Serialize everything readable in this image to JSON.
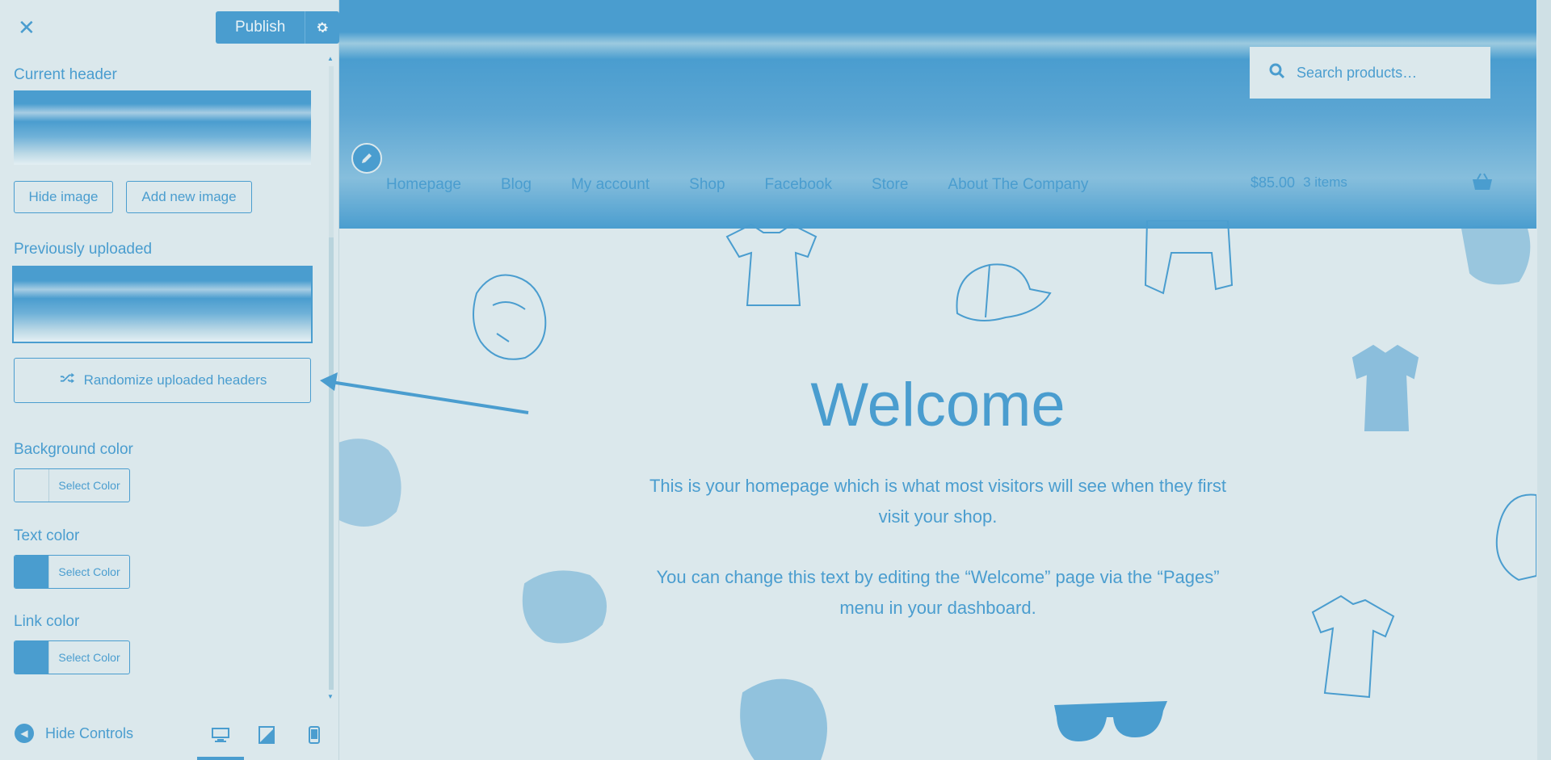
{
  "sidebar": {
    "close_icon": "close-icon",
    "publish_label": "Publish",
    "current_header_title": "Current header",
    "hide_image_label": "Hide image",
    "add_new_image_label": "Add new image",
    "previously_uploaded_title": "Previously uploaded",
    "randomize_label": "Randomize uploaded headers",
    "colors": [
      {
        "title": "Background color",
        "button_label": "Select Color",
        "swatch": "#dbe8ec"
      },
      {
        "title": "Text color",
        "button_label": "Select Color",
        "swatch": "#4a9dcf"
      },
      {
        "title": "Link color",
        "button_label": "Select Color",
        "swatch": "#4a9dcf"
      }
    ],
    "footer": {
      "hide_controls_label": "Hide Controls",
      "devices": [
        "desktop-icon",
        "tablet-icon",
        "mobile-icon"
      ],
      "active_device": "desktop"
    }
  },
  "preview": {
    "search_placeholder": "Search products…",
    "nav": [
      "Homepage",
      "Blog",
      "My account",
      "Shop",
      "Facebook",
      "Store",
      "About The Company"
    ],
    "cart_total": "$85.00",
    "cart_items": "3 items",
    "welcome_title": "Welcome",
    "paragraph1": "This is your homepage which is what most visitors will see when they first visit your shop.",
    "paragraph2": "You can change this text by editing the “Welcome” page via the “Pages” menu in your dashboard."
  },
  "colors": {
    "accent": "#4a9dcf",
    "background": "#dbe8ec"
  }
}
